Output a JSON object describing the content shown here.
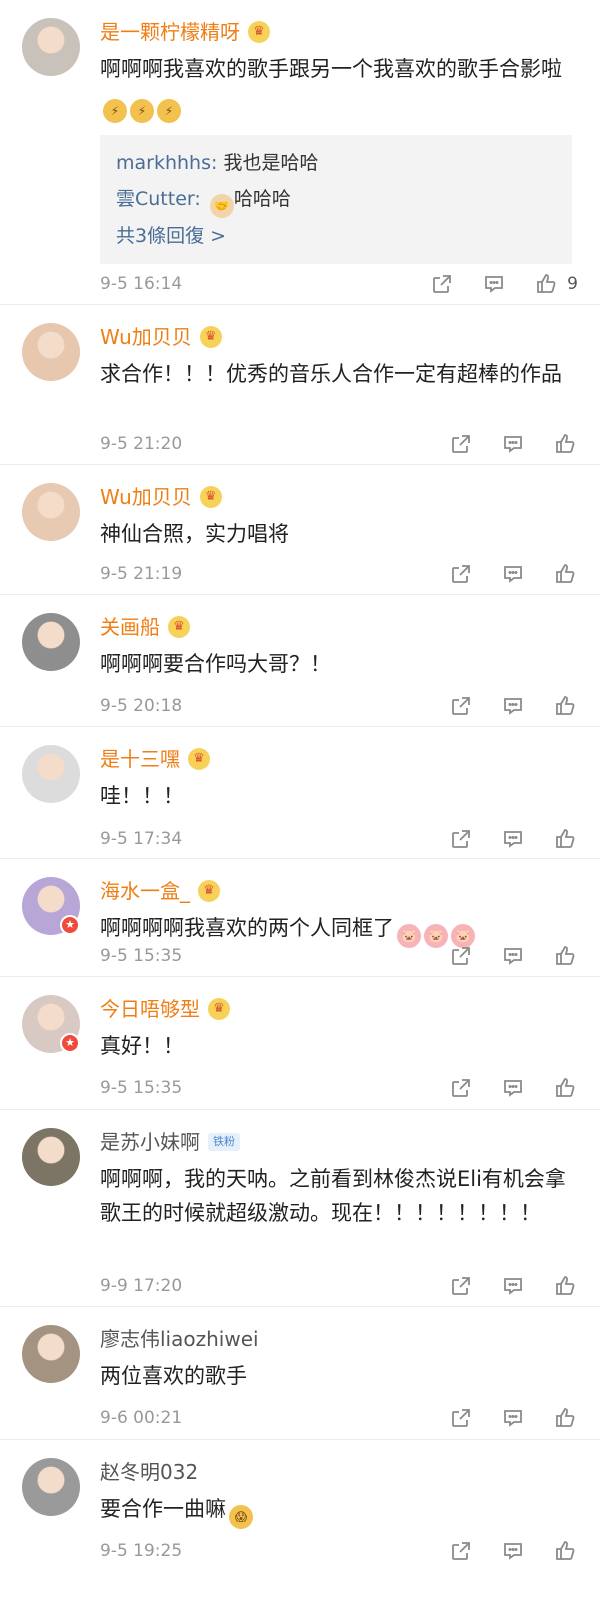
{
  "comments": [
    {
      "name": "是一颗柠檬精呀",
      "text": "啊啊啊我喜欢的歌手跟另一个我喜欢的歌手合影啦",
      "emojis": [
        "pikachu",
        "pikachu",
        "pikachu"
      ],
      "replies": [
        {
          "name": "markhhhs",
          "sep": ": ",
          "text": "我也是哈哈"
        },
        {
          "name": "雲Cutter",
          "sep": ": ",
          "text": "哈哈哈"
        }
      ],
      "more_replies": "共3條回復 >",
      "time": "9-5 16:14",
      "likes": "9",
      "name_style": "orange",
      "vip": true
    },
    {
      "name": "Wu加贝贝",
      "text": "求合作！！！优秀的音乐人合作一定有超棒的作品",
      "time": "9-5 21:20"
    },
    {
      "name": "Wu加贝贝",
      "text": "神仙合照，实力唱将",
      "time": "9-5 21:19"
    },
    {
      "name": "关画船",
      "text": "啊啊啊要合作吗大哥？！",
      "time": "9-5 20:18"
    },
    {
      "name": "是十三嘿",
      "text": "哇！！！",
      "time": "9-5 17:34"
    },
    {
      "name": "海水一盒_",
      "text": "啊啊啊啊我喜欢的两个人同框了",
      "emojis": [
        "pig",
        "pig",
        "pig"
      ],
      "time": "9-5 15:35"
    },
    {
      "name": "今日唔够型",
      "text": "真好！！",
      "time": "9-5 15:35"
    },
    {
      "name": "是苏小妹啊",
      "badge_text": "铁粉",
      "text": "啊啊啊，我的天呐。之前看到林俊杰说Eli有机会拿歌王的时候就超级激动。现在！！！！！！！！",
      "time": "9-9 17:20"
    },
    {
      "name": "廖志伟liaozhiwei",
      "text": "两位喜欢的歌手",
      "time": "9-6 00:21"
    },
    {
      "name": "赵冬明032",
      "text": "要合作一曲嘛",
      "emojis": [
        "scared"
      ],
      "time": "9-5 19:25"
    }
  ],
  "icons": {
    "share": "share-icon",
    "comment": "comment-icon",
    "like": "like-icon"
  },
  "colors": {
    "vip_name": "#f07e16",
    "normal_name": "#555555",
    "reply_name": "#4a6d95",
    "time": "#999999"
  }
}
